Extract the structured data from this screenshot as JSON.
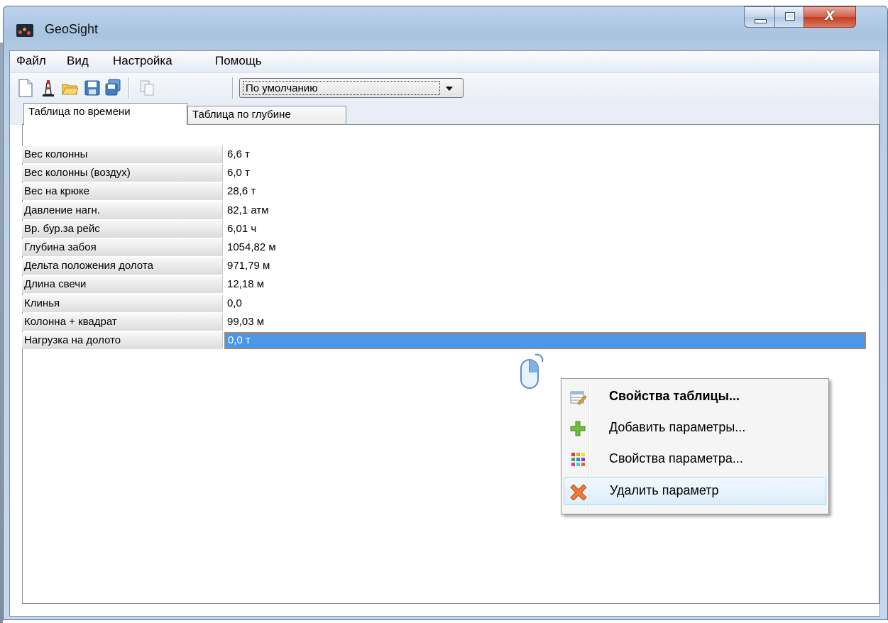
{
  "window": {
    "title": "GeoSight"
  },
  "menubar": {
    "items": [
      "Файл",
      "Вид",
      "Настройка",
      "Помощь"
    ]
  },
  "toolbar": {
    "icons": [
      "new-file-icon",
      "tower-icon",
      "open-folder-icon",
      "save-icon",
      "save-all-icon",
      "copy-icon"
    ],
    "preset_combo": {
      "value": "По умолчанию"
    }
  },
  "tabs": [
    {
      "label": "Таблица по времени",
      "active": true
    },
    {
      "label": "Таблица по глубине",
      "active": false
    }
  ],
  "table": {
    "rows": [
      {
        "label": "Вес колонны",
        "value": "6,6 т"
      },
      {
        "label": "Вес колонны (воздух)",
        "value": "6,0 т"
      },
      {
        "label": "Вес на крюке",
        "value": "28,6 т"
      },
      {
        "label": "Давление нагн.",
        "value": "82,1 атм"
      },
      {
        "label": "Вр. бур.за рейс",
        "value": "6,01 ч"
      },
      {
        "label": "Глубина забоя",
        "value": "1054,82 м"
      },
      {
        "label": "Дельта положения долота",
        "value": "971,79 м"
      },
      {
        "label": "Длина свечи",
        "value": "12,18 м"
      },
      {
        "label": "Клинья",
        "value": "0,0"
      },
      {
        "label": "Колонна + квадрат",
        "value": "99,03 м"
      },
      {
        "label": "Нагрузка на долото",
        "value": "0,0 т",
        "selected": true
      }
    ]
  },
  "context_menu": {
    "items": [
      {
        "label": "Свойства таблицы...",
        "icon": "table-properties-icon",
        "bold": true
      },
      {
        "label": "Добавить параметры...",
        "icon": "add-plus-icon"
      },
      {
        "label": "Свойства параметра...",
        "icon": "color-grid-icon"
      },
      {
        "label": "Удалить параметр",
        "icon": "delete-x-icon",
        "hover": true
      }
    ]
  },
  "colors": {
    "selection": "#4e97e6",
    "selection_border": "#e07a2a",
    "close_button": "#c23c22",
    "titlebar": "#b9cfe8"
  }
}
